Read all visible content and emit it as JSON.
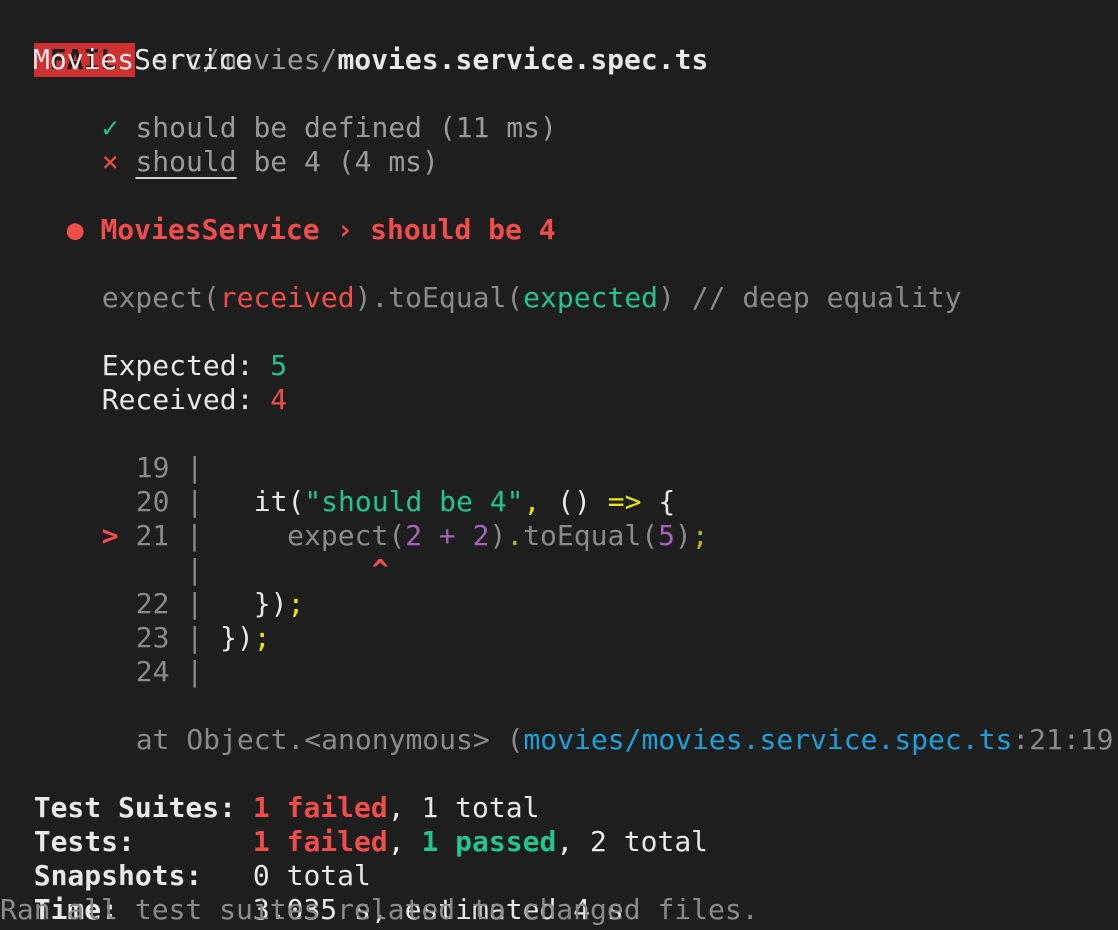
{
  "header": {
    "badge": "FAIL",
    "path_dir": "src/movies/",
    "path_file": "movies.service.spec.ts"
  },
  "suite": {
    "name": "MoviesService",
    "tests": [
      {
        "status_icon": "✓",
        "name_a": "should be defined",
        "time": " (11 ms)"
      },
      {
        "status_icon": "×",
        "name_a": "should",
        "name_b": " be 4",
        "time": " (4 ms)"
      }
    ]
  },
  "failure": {
    "bullet": "●",
    "title": "MoviesService › should be 4",
    "assertion": {
      "expect": "expect(",
      "received": "received",
      "mid": ").toEqual(",
      "expected": "expected",
      "end": ")",
      "comment": " // deep equality"
    },
    "expected_label": "Expected: ",
    "expected_value": "5",
    "received_label": "Received: ",
    "received_value": "4"
  },
  "code_frame": {
    "l19_num": "19",
    "l20_num": "20",
    "l21_num": "21",
    "l22_num": "22",
    "l23_num": "23",
    "l24_num": "24",
    "pipe": "|",
    "marker": ">",
    "caret": "^",
    "l20_it": "it(",
    "l20_str": "\"should be 4\"",
    "l20_comma": ",",
    "l20_arrow_a": " () ",
    "l20_arrow": "=>",
    "l20_brace": " {",
    "l21_expect": "expect(",
    "l21_two_a": "2",
    "l21_plus": " + ",
    "l21_two_b": "2",
    "l21_paren": ")",
    "l21_dot": ".",
    "l21_to": "toEqual(",
    "l21_five": "5",
    "l21_close": ")",
    "l21_semi": ";",
    "l22_a": "})",
    "l22_semi": ";",
    "l23_a": "})",
    "l23_semi": ";"
  },
  "stack": {
    "at": "at Object.<anonymous> (",
    "file": "movies/movies.service.spec.ts",
    "loc": ":21:19)"
  },
  "summary": {
    "suites_label": "Test Suites: ",
    "suites_failed": "1 failed",
    "suites_rest": ", 1 total",
    "tests_label": "Tests:       ",
    "tests_failed": "1 failed",
    "tests_sep": ", ",
    "tests_passed": "1 passed",
    "tests_rest": ", 2 total",
    "snap_label": "Snapshots:   ",
    "snap_value": "0 total",
    "time_label": "Time:        ",
    "time_value": "3.035 s, estimated 4 s",
    "footer": "Ran all test suites related to changed files."
  },
  "colors": {
    "background": "#1e1e1e",
    "fail_badge": "#cd3131",
    "pass_green": "#23c48e",
    "fail_red": "#f14c4c",
    "string_yellow": "#e5e510",
    "link_cyan": "#1e9fd8"
  }
}
